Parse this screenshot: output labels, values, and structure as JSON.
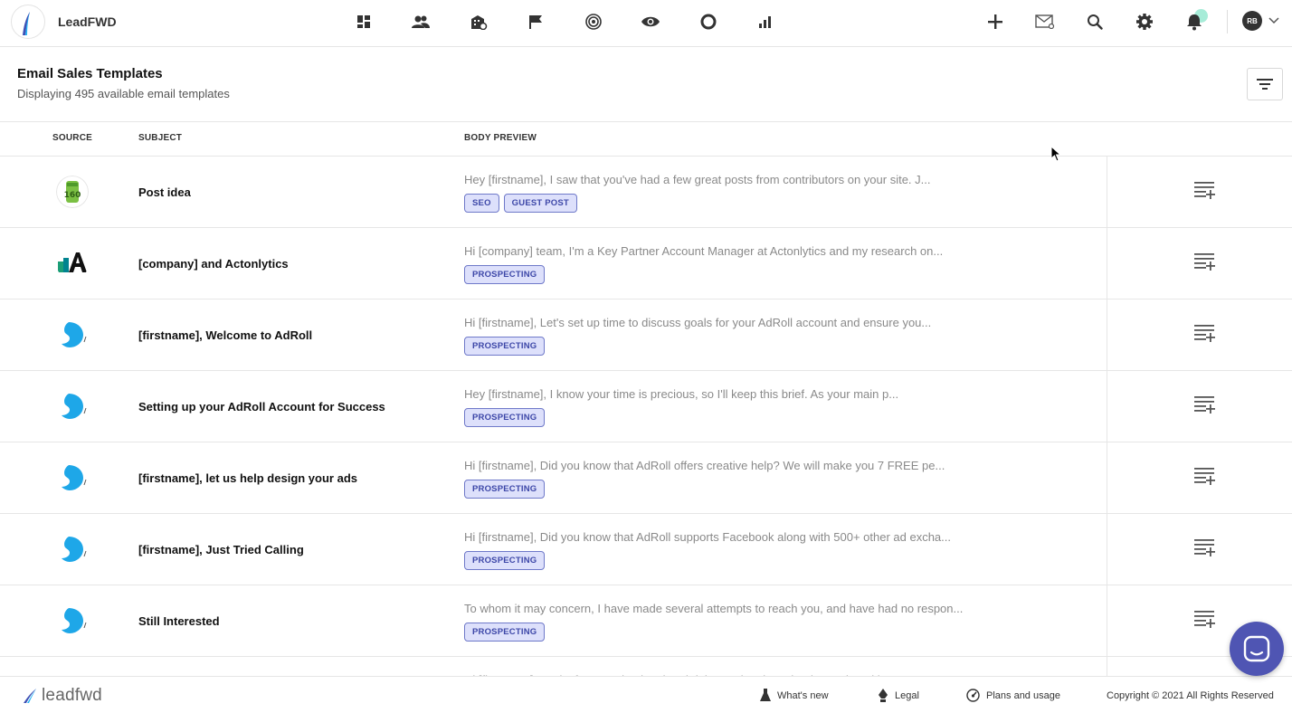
{
  "app": {
    "brand": "LeadFWD"
  },
  "nav": {
    "items": [
      {
        "name": "dashboard-icon"
      },
      {
        "name": "contacts-icon"
      },
      {
        "name": "companies-icon"
      },
      {
        "name": "campaigns-flag-icon"
      },
      {
        "name": "targets-icon"
      },
      {
        "name": "visitors-eye-icon"
      },
      {
        "name": "circle-icon"
      },
      {
        "name": "reports-chart-icon"
      }
    ],
    "right": [
      {
        "name": "add-icon"
      },
      {
        "name": "mail-icon"
      },
      {
        "name": "search-icon"
      },
      {
        "name": "settings-gear-icon"
      },
      {
        "name": "notifications-bell-icon"
      }
    ],
    "avatar_initials": "RB"
  },
  "header": {
    "title": "Email Sales Templates",
    "subtitle": "Displaying 495 available email templates"
  },
  "table": {
    "columns": {
      "source": "SOURCE",
      "subject": "SUBJECT",
      "preview": "BODY PREVIEW"
    },
    "rows": [
      {
        "source": "160",
        "subject": "Post idea",
        "preview": "Hey [firstname], I saw that you've had a few great posts from contributors on your site. J...",
        "tags": [
          "SEO",
          "GUEST POST"
        ]
      },
      {
        "source": "actonlytics",
        "subject": "[company] and Actonlytics",
        "preview": "Hi [company] team, I'm a Key Partner Account Manager at Actonlytics and my research on...",
        "tags": [
          "PROSPECTING"
        ]
      },
      {
        "source": "adroll",
        "subject": "[firstname], Welcome to AdRoll",
        "preview": "Hi [firstname], Let's set up time to discuss goals for your AdRoll account and ensure you...",
        "tags": [
          "PROSPECTING"
        ]
      },
      {
        "source": "adroll",
        "subject": "Setting up your AdRoll Account for Success",
        "preview": "Hey [firstname], I know your time is precious, so I'll keep this brief. As your main p...",
        "tags": [
          "PROSPECTING"
        ]
      },
      {
        "source": "adroll",
        "subject": "[firstname], let us help design your ads",
        "preview": "Hi [firstname], Did you know that AdRoll offers creative help? We will make you 7 FREE pe...",
        "tags": [
          "PROSPECTING"
        ]
      },
      {
        "source": "adroll",
        "subject": "[firstname], Just Tried Calling",
        "preview": "Hi [firstname], Did you know that AdRoll supports Facebook along with 500+ other ad excha...",
        "tags": [
          "PROSPECTING"
        ]
      },
      {
        "source": "adroll",
        "subject": "Still Interested",
        "preview": "To whom it may concern, I have made several attempts to reach you, and have had no respon...",
        "tags": [
          "PROSPECTING"
        ]
      },
      {
        "source": "adroll",
        "subject": "",
        "preview": "Hi [firstname], Looks for targeting is related doing and reviewed today and Looking at...",
        "tags": []
      }
    ]
  },
  "footer": {
    "logo_text": "leadfwd",
    "links": [
      "What's new",
      "Legal",
      "Plans and usage"
    ],
    "copyright": "Copyright © 2021 All Rights Reserved"
  },
  "colors": {
    "tag_bg": "#dde0fb",
    "tag_border": "#6f79c9",
    "tag_text": "#3d47a8",
    "chat": "#4f55b3",
    "adroll_blue": "#1ea7e8"
  }
}
